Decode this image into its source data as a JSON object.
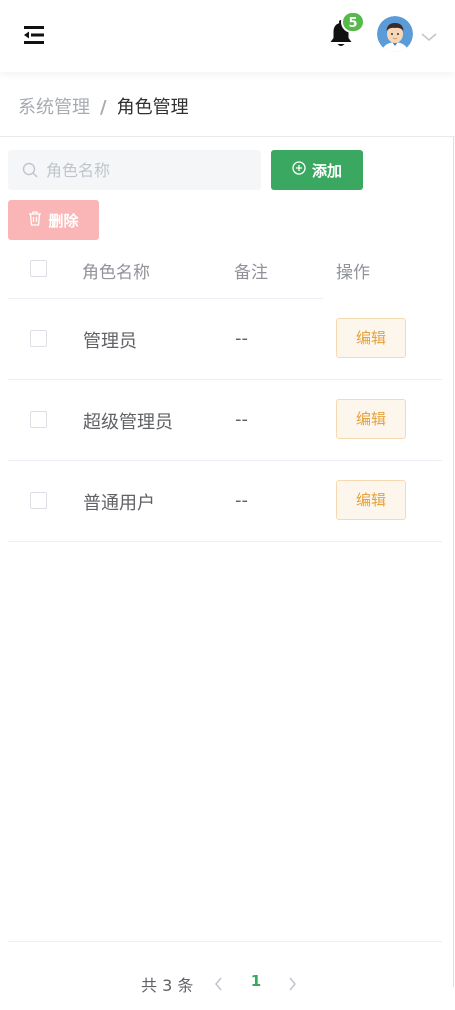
{
  "header": {
    "notification_count": "5",
    "colors": {
      "badge": "#57b94a"
    }
  },
  "breadcrumb": {
    "parent": "系统管理",
    "separator": "/",
    "current": "角色管理"
  },
  "toolbar": {
    "search_placeholder": "角色名称",
    "add_label": "添加",
    "delete_label": "删除",
    "colors": {
      "add": "#3aa861",
      "delete": "#fab6b6"
    }
  },
  "table": {
    "columns": [
      "角色名称",
      "备注",
      "操作"
    ],
    "rows": [
      {
        "name": "管理员",
        "remark": "--",
        "action": "编辑"
      },
      {
        "name": "超级管理员",
        "remark": "--",
        "action": "编辑"
      },
      {
        "name": "普通用户",
        "remark": "--",
        "action": "编辑"
      }
    ]
  },
  "pagination": {
    "total_text": "共 3 条",
    "current_page": "1"
  }
}
